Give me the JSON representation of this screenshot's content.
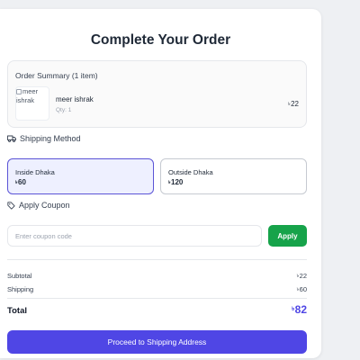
{
  "page": {
    "title": "Complete Your Order"
  },
  "order_summary": {
    "heading": "Order Summary (1 item)",
    "item": {
      "image_alt": "meer ishrak",
      "name": "meer ishrak",
      "qty": "Qty: 1",
      "currency": "৳",
      "price": "22"
    }
  },
  "shipping": {
    "heading": "Shipping Method",
    "icon": "truck-icon",
    "options": [
      {
        "label": "Inside Dhaka",
        "currency": "৳",
        "price": "60",
        "selected": true
      },
      {
        "label": "Outside Dhaka",
        "currency": "৳",
        "price": "120",
        "selected": false
      }
    ]
  },
  "coupon": {
    "heading": "Apply Coupon",
    "icon": "tag-icon",
    "placeholder": "Enter coupon code",
    "value": "",
    "button_label": "Apply"
  },
  "totals": {
    "currency": "৳",
    "subtotal_label": "Subtotal",
    "subtotal_value": "22",
    "shipping_label": "Shipping",
    "shipping_value": "60",
    "total_label": "Total",
    "total_value": "82"
  },
  "cta": {
    "label": "Proceed to Shipping Address"
  },
  "colors": {
    "accent": "#4f46e5",
    "apply_button": "#16a34a",
    "selected_option_bg": "#eef0ff"
  }
}
